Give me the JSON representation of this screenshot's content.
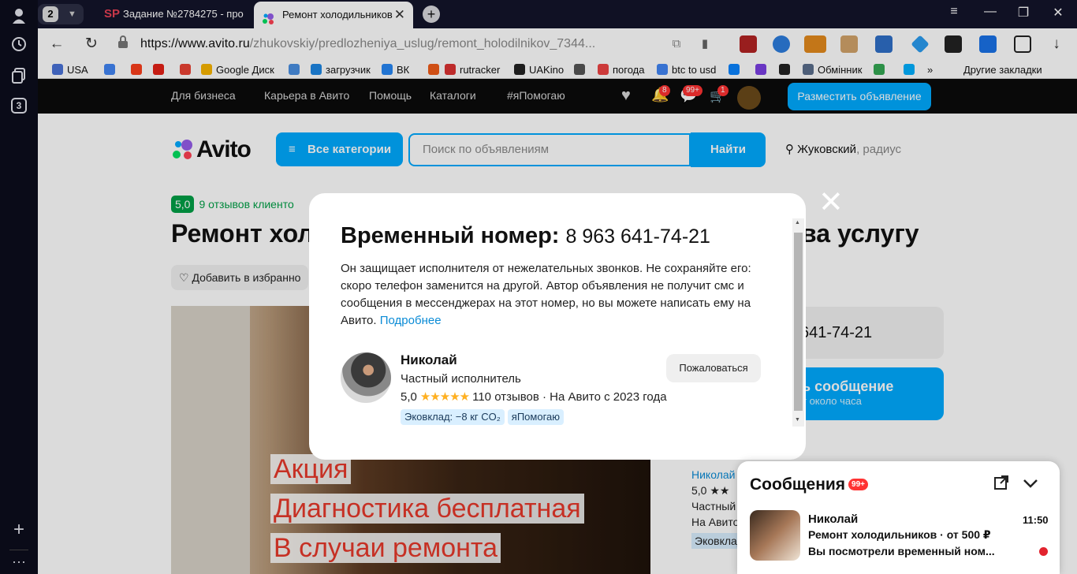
{
  "browser": {
    "tab_count": "2",
    "tabs": [
      {
        "label": "Задание №2784275 - про"
      },
      {
        "label": "Ремонт холодильников"
      }
    ],
    "url_host": "https://www.avito.ru",
    "url_path": "/zhukovskiy/predlozheniya_uslug/remont_holodilnikov_7344..."
  },
  "rail": {
    "tab_num": "3"
  },
  "bookmarks": [
    {
      "label": "USA",
      "color": "#4a73d8"
    },
    {
      "label": "",
      "color": "#4285f4"
    },
    {
      "label": "",
      "color": "#fc3f1d"
    },
    {
      "label": "",
      "color": "#e62117"
    },
    {
      "label": "",
      "color": "#ea4335"
    },
    {
      "label": "Google Диск",
      "color": "#f8b500"
    },
    {
      "label": "",
      "color": "#4a90e2"
    },
    {
      "label": "загрузчик",
      "color": "#1e88e5"
    },
    {
      "label": "ВК",
      "color": "#2787f5"
    },
    {
      "label": "",
      "color": "#f25c19"
    },
    {
      "label": "rutracker",
      "color": "#d33"
    },
    {
      "label": "UAKino",
      "color": "#222"
    },
    {
      "label": "",
      "color": "#555"
    },
    {
      "label": "погода",
      "color": "#e44"
    },
    {
      "label": "btc to usd",
      "color": "#4285f4"
    },
    {
      "label": "",
      "color": "#0a84ff"
    },
    {
      "label": "",
      "color": "#7b3fe4"
    },
    {
      "label": "",
      "color": "#222"
    },
    {
      "label": "Обмінник",
      "color": "#5a6e8c"
    },
    {
      "label": "",
      "color": "#34a853"
    },
    {
      "label": "",
      "color": "#00b0ff"
    },
    {
      "label": "»",
      "color": "#fff"
    },
    {
      "label": "Другие закладки",
      "color": "#fff"
    }
  ],
  "avito": {
    "nav": [
      "Для бизнеса",
      "Карьера в Авито",
      "Помощь",
      "Каталоги",
      "#яПомогаю"
    ],
    "badges": [
      "8",
      "99+",
      "1"
    ],
    "post_ad": "Разместить объявление",
    "logo": "Avito",
    "all_categories": "Все категории",
    "search_placeholder": "Поиск по объявлениям",
    "find": "Найти",
    "location": "Жуковский",
    "radius": ", радиус",
    "rating_value": "5,0",
    "rating_reviews": "9 отзывов клиенто",
    "title_left": "Ремонт хол",
    "title_right": "ва услугу",
    "favorite": "Добавить в избранно",
    "promo": [
      "Акция",
      "Диагностика бесплатная",
      "В случаи ремонта"
    ],
    "phone_partial": "641-74-21",
    "msg_line1": "ь сообщение",
    "msg_line2": "т около часа",
    "seller_lines": [
      "Николай",
      "5,0 ★★",
      "Частный",
      "На Авито",
      "Эковклад"
    ]
  },
  "modal": {
    "heading": "Временный номер:",
    "number": "8 963 641-74-21",
    "description": "Он защищает исполнителя от нежелательных звонков. Не сохраняйте его: скоро телефон заменится на другой. Автор объявления не получит смс и сообщения в мессенджерах на этот номер, но вы можете написать ему на Авито.",
    "more_link": "Подробнее",
    "seller_name": "Николай",
    "seller_type": "Частный исполнитель",
    "rating": "5,0",
    "stars": "★★★★★",
    "reviews_and_since": "110 отзывов · На Авито с 2023 года",
    "tags": [
      "Эковклад: −8 кг CO₂",
      "яПомогаю"
    ],
    "report": "Пожаловаться"
  },
  "chat": {
    "title": "Сообщения",
    "badge": "99+",
    "sender": "Николай",
    "topic": "Ремонт холодильников · от 500 ₽",
    "preview": "Вы посмотрели временный ном...",
    "time": "11:50"
  }
}
